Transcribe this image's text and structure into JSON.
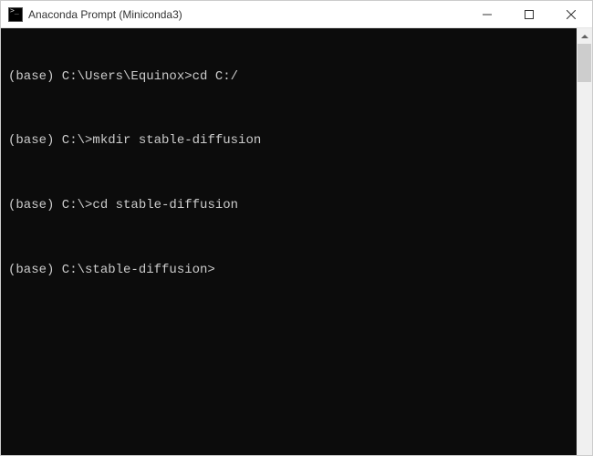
{
  "window": {
    "title": "Anaconda Prompt (Miniconda3)"
  },
  "terminal": {
    "lines": [
      {
        "prompt": "(base) C:\\Users\\Equinox>",
        "command": "cd C:/"
      },
      {
        "prompt": "(base) C:\\>",
        "command": "mkdir stable-diffusion"
      },
      {
        "prompt": "(base) C:\\>",
        "command": "cd stable-diffusion"
      }
    ],
    "current_prompt": "(base) C:\\stable-diffusion>"
  }
}
